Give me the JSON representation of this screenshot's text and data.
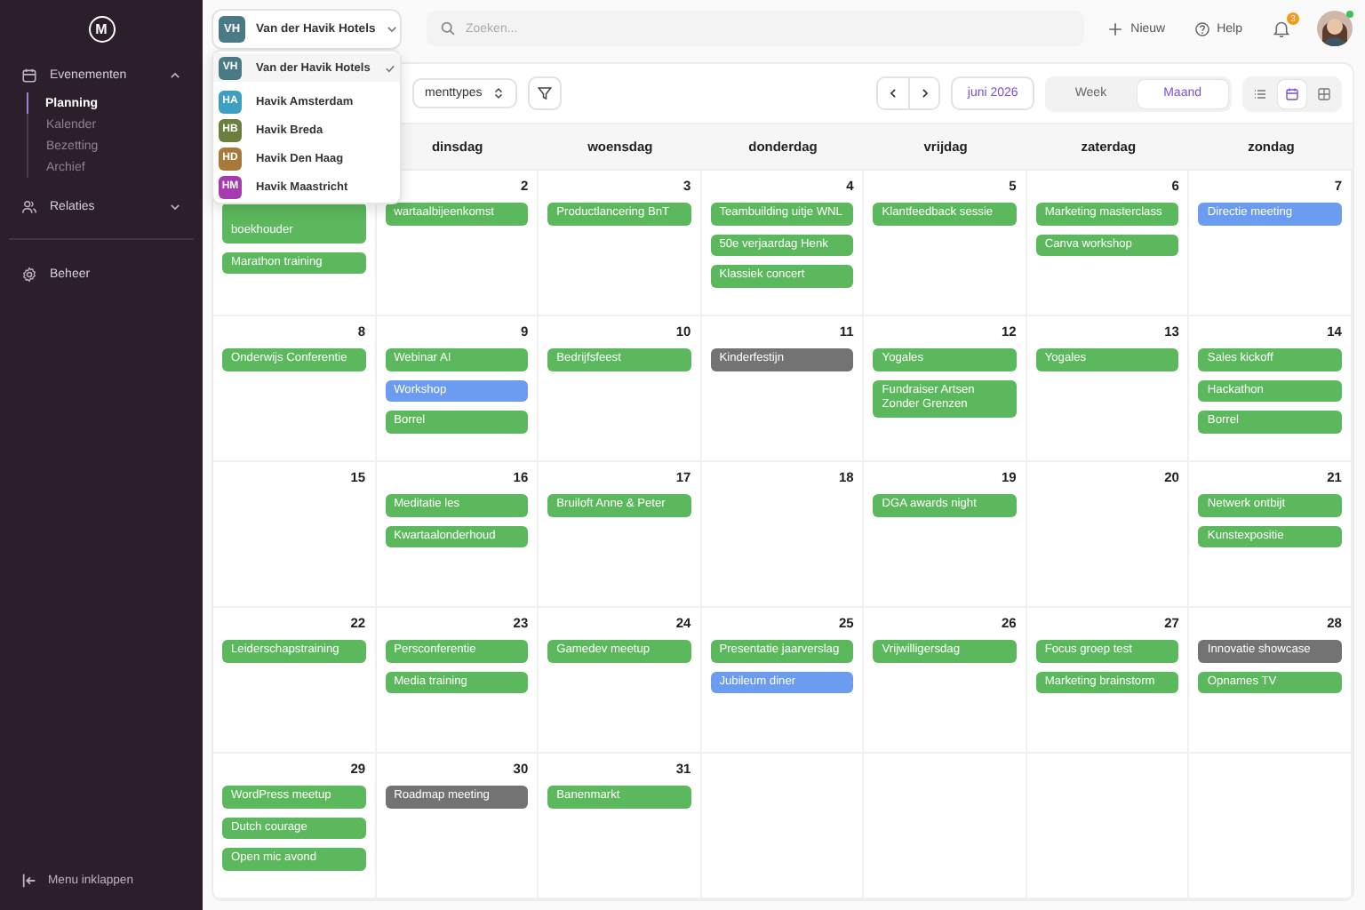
{
  "sidebar": {
    "logo": "M",
    "nav": [
      {
        "label": "Evenementen",
        "expanded": true,
        "children": [
          {
            "label": "Planning",
            "selected": true
          },
          {
            "label": "Kalender",
            "selected": false
          },
          {
            "label": "Bezetting",
            "selected": false
          },
          {
            "label": "Archief",
            "selected": false
          }
        ]
      },
      {
        "label": "Relaties",
        "expanded": false
      },
      {
        "label": "Beheer"
      }
    ],
    "collapse": "Menu inklappen"
  },
  "org_select": {
    "initials": "VH",
    "label": "Van der Havik Hotels",
    "color": "#4a7a86"
  },
  "org_menu": [
    {
      "initials": "VH",
      "label": "Van der Havik Hotels",
      "color": "#4a7a86",
      "selected": true
    },
    {
      "initials": "HA",
      "label": "Havik Amsterdam",
      "color": "#3e9fc0",
      "selected": false
    },
    {
      "initials": "HB",
      "label": "Havik Breda",
      "color": "#6b7f3e",
      "selected": false
    },
    {
      "initials": "HD",
      "label": "Havik Den Haag",
      "color": "#a77a3c",
      "selected": false
    },
    {
      "initials": "HM",
      "label": "Havik Maastricht",
      "color": "#a63bb0",
      "selected": false
    }
  ],
  "search": {
    "placeholder": "Zoeken..."
  },
  "top_actions": [
    {
      "label": "Nieuw"
    },
    {
      "label": "Help"
    }
  ],
  "notifications": {
    "count": "3"
  },
  "toolbar": {
    "type_filter": "menttypes",
    "month": "juni 2026",
    "views": [
      {
        "label": "Week",
        "selected": false
      },
      {
        "label": "Maand",
        "selected": true
      }
    ],
    "layouts": [
      {
        "selected": false
      },
      {
        "selected": true
      },
      {
        "selected": false
      }
    ]
  },
  "weekdays": [
    "dinsdag",
    "woensdag",
    "donderdag",
    "vrijdag",
    "zaterdag",
    "zondag"
  ],
  "weeks": [
    [
      {
        "events": [
          {
            "title": "boekhouder",
            "color": "#5cb85c",
            "tall": true
          },
          {
            "title": "Marathon training",
            "color": "#5cb85c"
          }
        ]
      },
      {
        "date": "2",
        "events": [
          {
            "title": "wartaalbijeenkomst",
            "color": "#5cb85c"
          }
        ]
      },
      {
        "date": "3",
        "events": [
          {
            "title": "Productlancering BnT",
            "color": "#5cb85c"
          }
        ]
      },
      {
        "date": "4",
        "events": [
          {
            "title": "Teambuilding uitje WNL",
            "color": "#5cb85c"
          },
          {
            "title": "50e verjaardag Henk",
            "color": "#5cb85c"
          },
          {
            "title": "Klassiek concert",
            "color": "#5cb85c"
          }
        ]
      },
      {
        "date": "5",
        "events": [
          {
            "title": "Klantfeedback sessie",
            "color": "#5cb85c"
          }
        ]
      },
      {
        "date": "6",
        "events": [
          {
            "title": "Marketing masterclass",
            "color": "#5cb85c"
          },
          {
            "title": "Canva workshop",
            "color": "#5cb85c"
          }
        ]
      },
      {
        "date": "7",
        "events": [
          {
            "title": "Directie meeting",
            "color": "#6b9cf0"
          }
        ]
      }
    ],
    [
      {
        "date": "8",
        "events": [
          {
            "title": "Onderwijs Conferentie",
            "color": "#5cb85c"
          }
        ]
      },
      {
        "date": "9",
        "events": [
          {
            "title": "Webinar AI",
            "color": "#5cb85c"
          },
          {
            "title": "Workshop",
            "color": "#6b9cf0"
          },
          {
            "title": "Borrel",
            "color": "#5cb85c"
          }
        ]
      },
      {
        "date": "10",
        "events": [
          {
            "title": "Bedrijfsfeest",
            "color": "#5cb85c"
          }
        ]
      },
      {
        "date": "11",
        "events": [
          {
            "title": "Kinderfestijn",
            "color": "#737373"
          }
        ]
      },
      {
        "date": "12",
        "events": [
          {
            "title": "Yogales",
            "color": "#5cb85c"
          },
          {
            "title": "Fundraiser Artsen Zonder Grenzen",
            "color": "#5cb85c"
          }
        ]
      },
      {
        "date": "13",
        "events": [
          {
            "title": "Yogales",
            "color": "#5cb85c"
          }
        ]
      },
      {
        "date": "14",
        "events": [
          {
            "title": "Sales kickoff",
            "color": "#5cb85c"
          },
          {
            "title": "Hackathon",
            "color": "#5cb85c"
          },
          {
            "title": "Borrel",
            "color": "#5cb85c"
          }
        ]
      }
    ],
    [
      {
        "date": "15"
      },
      {
        "date": "16",
        "events": [
          {
            "title": "Meditatie les",
            "color": "#5cb85c"
          },
          {
            "title": "Kwartaalonderhoud",
            "color": "#5cb85c"
          }
        ]
      },
      {
        "date": "17",
        "events": [
          {
            "title": "Bruiloft Anne & Peter",
            "color": "#5cb85c"
          }
        ]
      },
      {
        "date": "18"
      },
      {
        "date": "19",
        "events": [
          {
            "title": "DGA awards night",
            "color": "#5cb85c"
          }
        ]
      },
      {
        "date": "20"
      },
      {
        "date": "21",
        "events": [
          {
            "title": "Netwerk ontbijt",
            "color": "#5cb85c"
          },
          {
            "title": "Kunstexpositie",
            "color": "#5cb85c"
          }
        ]
      }
    ],
    [
      {
        "date": "22",
        "events": [
          {
            "title": "Leiderschapstraining",
            "color": "#5cb85c"
          }
        ]
      },
      {
        "date": "23",
        "events": [
          {
            "title": "Persconferentie",
            "color": "#5cb85c"
          },
          {
            "title": "Media training",
            "color": "#5cb85c"
          }
        ]
      },
      {
        "date": "24",
        "events": [
          {
            "title": "Gamedev meetup",
            "color": "#5cb85c"
          }
        ]
      },
      {
        "date": "25",
        "events": [
          {
            "title": "Presentatie jaarverslag",
            "color": "#5cb85c"
          },
          {
            "title": "Jubileum diner",
            "color": "#6b9cf0"
          }
        ]
      },
      {
        "date": "26",
        "events": [
          {
            "title": "Vrijwilligersdag",
            "color": "#5cb85c"
          }
        ]
      },
      {
        "date": "27",
        "events": [
          {
            "title": "Focus groep test",
            "color": "#5cb85c"
          },
          {
            "title": "Marketing brainstorm",
            "color": "#5cb85c"
          }
        ]
      },
      {
        "date": "28",
        "events": [
          {
            "title": "Innovatie showcase",
            "color": "#737373"
          },
          {
            "title": "Opnames TV",
            "color": "#5cb85c"
          }
        ]
      }
    ],
    [
      {
        "date": "29",
        "events": [
          {
            "title": "WordPress meetup",
            "color": "#5cb85c"
          },
          {
            "title": "Dutch courage",
            "color": "#5cb85c"
          },
          {
            "title": "Open mic avond",
            "color": "#5cb85c"
          }
        ]
      },
      {
        "date": "30",
        "events": [
          {
            "title": "Roadmap meeting",
            "color": "#737373"
          }
        ]
      },
      {
        "date": "31",
        "events": [
          {
            "title": "Banenmarkt",
            "color": "#5cb85c"
          }
        ]
      }
    ]
  ]
}
